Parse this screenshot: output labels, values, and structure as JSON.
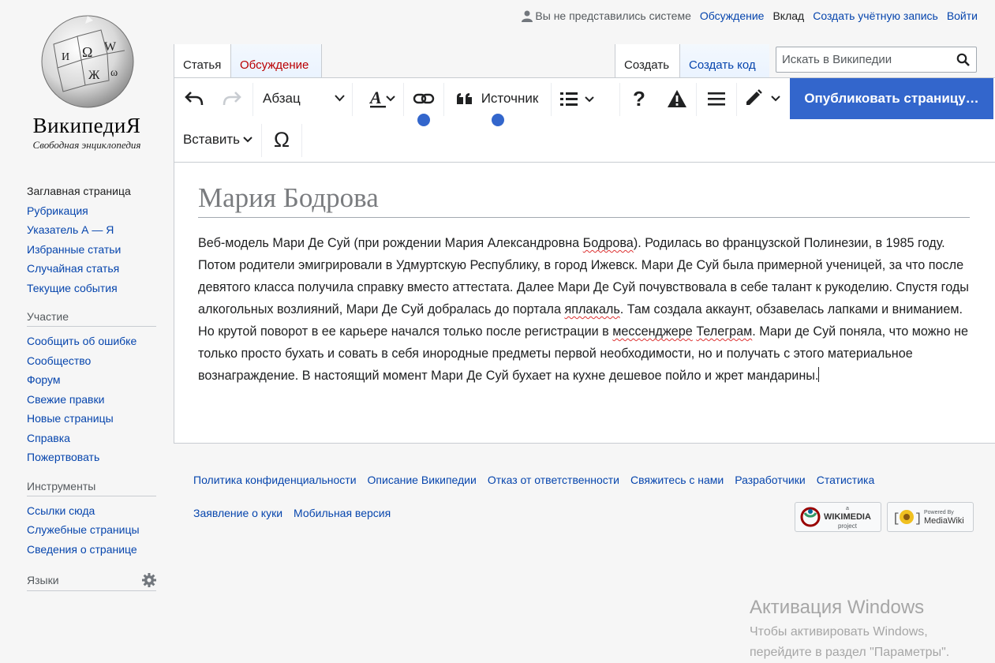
{
  "logo": {
    "wordmark": "ВикипедиЯ",
    "tagline": "Свободная энциклопедия"
  },
  "personal": {
    "anon": "Вы не представились системе",
    "talk": "Обсуждение",
    "contributions": "Вклад",
    "create_account": "Создать учётную запись",
    "login": "Войти"
  },
  "tabs": {
    "article": "Статья",
    "talk": "Обсуждение",
    "create": "Создать",
    "create_code": "Создать код"
  },
  "search": {
    "placeholder": "Искать в Википедии"
  },
  "toolbar": {
    "paragraph": "Абзац",
    "source": "Источник",
    "insert": "Вставить",
    "help": "?",
    "omega": "Ω",
    "publish": "Опубликовать страницу…"
  },
  "article": {
    "title": "Мария Бодрова",
    "text": [
      "Веб-модель Мари Де Суй (при рождении Мария Александровна ",
      "Бодрова",
      "). Родилась во французской Полинезии, в 1985 году. Потом родители эмигрировали в Удмуртскую Республику, в город Ижевск. Мари Де Суй была примерной ученицей, за что после девятого класса получила справку вместо аттестата. Далее Мари Де Суй почувствовала в себе талант к рукоделию. Спустя годы алкогольных возлияний, Мари Де Суй добралась до портала ",
      "яплакаль",
      ". Там создала аккаунт, обзавелась лапками и вниманием. Но крутой поворот в ее карьере начался только после регистрации в ",
      "мессенджере",
      " ",
      "Телеграм",
      ". Мари де Суй поняла, что можно не только просто бухать и совать в себя инородные предметы первой необходимости, но и получать с этого материальное вознаграждение. В настоящий момент Мари Де Суй бухает на кухне дешевое пойло и жрет мандарины."
    ]
  },
  "sidebar": {
    "nav": [
      "Заглавная страница",
      "Рубрикация",
      "Указатель А — Я",
      "Избранные статьи",
      "Случайная статья",
      "Текущие события"
    ],
    "participation_heading": "Участие",
    "participation": [
      "Сообщить об ошибке",
      "Сообщество",
      "Форум",
      "Свежие правки",
      "Новые страницы",
      "Справка",
      "Пожертвовать"
    ],
    "tools_heading": "Инструменты",
    "tools": [
      "Ссылки сюда",
      "Служебные страницы",
      "Сведения о странице"
    ],
    "languages_heading": "Языки"
  },
  "footer": {
    "row1": [
      "Политика конфиденциальности",
      "Описание Википедии",
      "Отказ от ответственности",
      "Свяжитесь с нами",
      "Разработчики",
      "Статистика"
    ],
    "row2": [
      "Заявление о куки",
      "Мобильная версия"
    ],
    "wikimedia": {
      "top": "a",
      "main": "WIKIMEDIA",
      "bottom": "project"
    },
    "mediawiki": {
      "top": "Powered By",
      "main": "MediaWiki"
    }
  },
  "watermark": {
    "title": "Активация Windows",
    "line1": "Чтобы активировать Windows,",
    "line2": "перейдите в раздел \"Параметры\"."
  },
  "colors": {
    "link": "#0645ad",
    "accent": "#3366cc",
    "talk_red": "#ba0000"
  }
}
